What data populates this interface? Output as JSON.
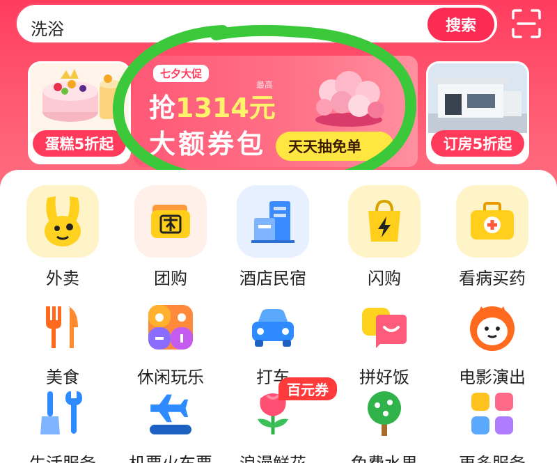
{
  "search": {
    "query": "洗浴",
    "button_label": "搜索"
  },
  "banners": {
    "left_label": "蛋糕5折起",
    "right_label": "订房5折起",
    "promo": {
      "tag": "七夕大促",
      "max_label": "最高",
      "line1_prefix": "抢",
      "line1_amount": "1314元",
      "line2": "大额券包",
      "button_label": "天天抽免单"
    }
  },
  "grid": {
    "row1": [
      "外卖",
      "团购",
      "酒店民宿",
      "闪购",
      "看病买药"
    ],
    "row2": [
      "美食",
      "休闲玩乐",
      "打车",
      "拼好饭",
      "电影演出"
    ],
    "row3": [
      "生活服务",
      "机票火车票",
      "浪漫鲜花",
      "免费水果",
      "更多服务"
    ]
  },
  "flower_badge": "百元券",
  "icons": [
    "scan-icon",
    "waimai-mascot-icon",
    "tuangou-ticket-icon",
    "hotel-building-icon",
    "shangou-bag-icon",
    "medicine-kit-icon",
    "fork-knife-icon",
    "leisure-grid-icon",
    "car-icon",
    "pinhaofan-chat-icon",
    "cat-face-icon",
    "service-tools-icon",
    "plane-train-icon",
    "flower-icon",
    "fruit-tree-icon",
    "more-services-icon"
  ],
  "colors": {
    "brand": "#fb2b53",
    "ring": "#3bc93b",
    "promo_button": "#ffe640"
  }
}
